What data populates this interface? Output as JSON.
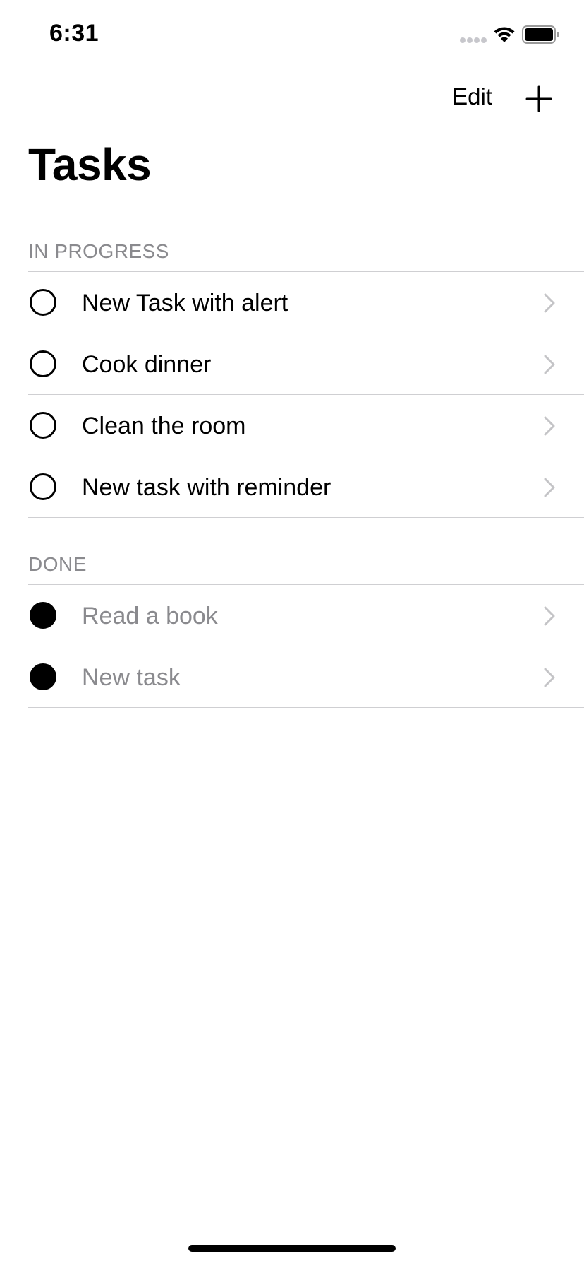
{
  "status_bar": {
    "time": "6:31"
  },
  "nav": {
    "edit_label": "Edit",
    "add_icon": "plus-icon"
  },
  "title": "Tasks",
  "sections": [
    {
      "header": "IN PROGRESS",
      "tasks": [
        {
          "label": "New Task with alert",
          "done": false
        },
        {
          "label": "Cook dinner",
          "done": false
        },
        {
          "label": "Clean the room",
          "done": false
        },
        {
          "label": "New task with reminder",
          "done": false
        }
      ]
    },
    {
      "header": "DONE",
      "tasks": [
        {
          "label": "Read a book",
          "done": true
        },
        {
          "label": "New task",
          "done": true
        }
      ]
    }
  ],
  "colors": {
    "secondary_text": "#8a8a8e",
    "separator": "#cfcfd2",
    "chevron": "#c4c4c7"
  }
}
